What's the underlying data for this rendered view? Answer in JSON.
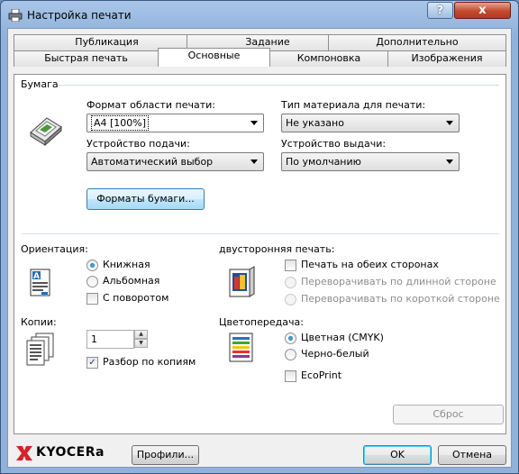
{
  "window": {
    "title": "Настройка печати",
    "help_label": "?",
    "close_label": "x"
  },
  "tabs_top": [
    "Публикация",
    "Задание",
    "Дополнительно"
  ],
  "tabs_bottom": [
    "Быстрая печать",
    "Основные",
    "Компоновка",
    "Изображения"
  ],
  "paper": {
    "group_label": "Бумага",
    "print_area_label": "Формат области печати:",
    "print_area_value": "A4 [100%]",
    "media_type_label": "Тип материала для печати:",
    "media_type_value": "Не указано",
    "source_label": "Устройство подачи:",
    "source_value": "Автоматический выбор",
    "output_label": "Устройство выдачи:",
    "output_value": "По умолчанию",
    "paper_sizes_button": "Форматы бумаги..."
  },
  "orientation": {
    "label": "Ориентация:",
    "portrait": "Книжная",
    "landscape": "Альбомная",
    "rotated": "С поворотом",
    "selected": "portrait"
  },
  "duplex": {
    "label": "двусторонняя печать:",
    "both_sides": "Печать на обеих сторонах",
    "long_edge": "Переворачивать по длинной стороне",
    "short_edge": "Переворачивать по короткой стороне"
  },
  "copies": {
    "label": "Копии:",
    "value": "1",
    "collate": "Разбор по копиям",
    "collate_checked": true
  },
  "color": {
    "label": "Цветопередача:",
    "color_option": "Цветная (CMYK)",
    "bw_option": "Черно-белый",
    "selected": "color",
    "ecoprint": "EcoPrint"
  },
  "reset_button": "Сброс",
  "footer": {
    "brand": "KYOCERa",
    "profiles_button": "Профили...",
    "ok_button": "OK",
    "cancel_button": "Отмена"
  },
  "colors": {
    "accent": "#3c7fb1",
    "brand_red": "#d6232b"
  }
}
